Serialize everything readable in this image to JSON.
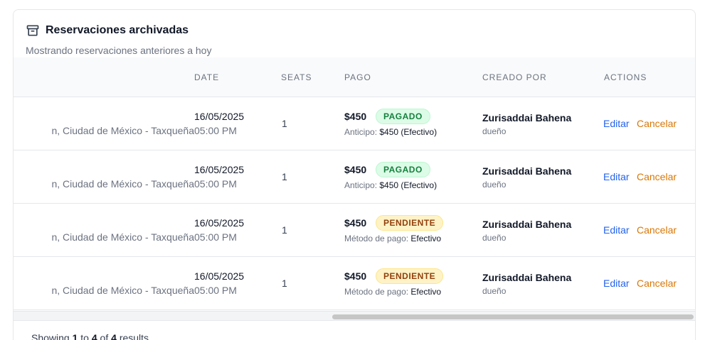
{
  "card": {
    "title": "Reservaciones archivadas",
    "subtitle": "Mostrando reservaciones anteriores a hoy"
  },
  "table": {
    "columns": [
      "",
      "DATE",
      "SEATS",
      "PAGO",
      "CREADO POR",
      "ACTIONS"
    ],
    "rows": [
      {
        "location": "n, Ciudad de México - Taxqueña",
        "date": "16/05/2025",
        "time": "05:00 PM",
        "seats": "1",
        "amount": "$450",
        "status": "PAGADO",
        "detail_label": "Anticipo:",
        "detail_value": "$450 (Efectivo)",
        "creator": "Zurisaddai Bahena",
        "role": "dueño",
        "edit": "Editar",
        "cancel": "Cancelar"
      },
      {
        "location": "n, Ciudad de México - Taxqueña",
        "date": "16/05/2025",
        "time": "05:00 PM",
        "seats": "1",
        "amount": "$450",
        "status": "PAGADO",
        "detail_label": "Anticipo:",
        "detail_value": "$450 (Efectivo)",
        "creator": "Zurisaddai Bahena",
        "role": "dueño",
        "edit": "Editar",
        "cancel": "Cancelar"
      },
      {
        "location": "n, Ciudad de México - Taxqueña",
        "date": "16/05/2025",
        "time": "05:00 PM",
        "seats": "1",
        "amount": "$450",
        "status": "PENDIENTE",
        "detail_label": "Método de pago:",
        "detail_value": "Efectivo",
        "creator": "Zurisaddai Bahena",
        "role": "dueño",
        "edit": "Editar",
        "cancel": "Cancelar"
      },
      {
        "location": "n, Ciudad de México - Taxqueña",
        "date": "16/05/2025",
        "time": "05:00 PM",
        "seats": "1",
        "amount": "$450",
        "status": "PENDIENTE",
        "detail_label": "Método de pago:",
        "detail_value": "Efectivo",
        "creator": "Zurisaddai Bahena",
        "role": "dueño",
        "edit": "Editar",
        "cancel": "Cancelar"
      }
    ]
  },
  "footer": {
    "showing": "Showing",
    "from": "1",
    "to_word": "to",
    "to": "4",
    "of_word": "of",
    "total": "4",
    "results": "results"
  },
  "colors": {
    "paid_bg": "#dcfce7",
    "paid_text": "#15803d",
    "pending_bg": "#fef3c7",
    "pending_text": "#92400e",
    "edit_link": "#2563eb",
    "cancel_link": "#d97706"
  },
  "icons": {
    "title_icon": "archive-icon"
  }
}
